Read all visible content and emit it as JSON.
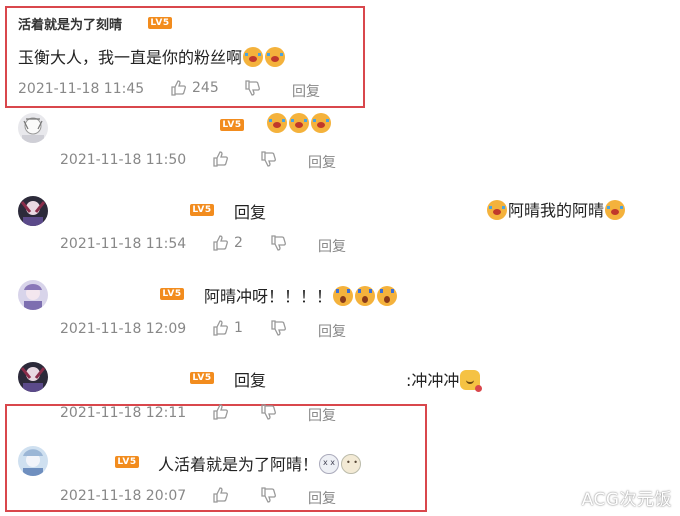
{
  "comments": [
    {
      "username": "活着就是为了刻晴",
      "level_badge": "LV5",
      "content": "玉衡大人，我一直是你的粉丝啊",
      "timestamp": "2021-11-18 11:45",
      "likes": "245",
      "reply_label": "回复"
    },
    {
      "username": "",
      "level_badge": "LV5",
      "content": "",
      "timestamp": "2021-11-18 11:50",
      "likes": "",
      "reply_label": "回复"
    },
    {
      "username": "",
      "level_badge": "LV5",
      "reply_prefix": "回复",
      "content": "阿晴我的阿晴",
      "timestamp": "2021-11-18 11:54",
      "likes": "2",
      "reply_label": "回复"
    },
    {
      "username": "",
      "level_badge": "LV5",
      "content": "阿晴冲呀！！！！",
      "timestamp": "2021-11-18 12:09",
      "likes": "1",
      "reply_label": "回复"
    },
    {
      "username": "",
      "level_badge": "LV5",
      "reply_prefix": "回复",
      "content": ":冲冲冲",
      "timestamp": "2021-11-18 12:11",
      "likes": "",
      "reply_label": "回复"
    },
    {
      "username": "",
      "level_badge": "LV5",
      "content": "人活着就是为了阿晴！",
      "timestamp": "2021-11-18 20:07",
      "likes": "",
      "reply_label": "回复"
    }
  ],
  "colors": {
    "highlight_border": "#d9474c",
    "level_badge": "#f28c1e",
    "meta_text": "#888888"
  },
  "icons": [
    "thumbs-up-icon",
    "thumbs-down-icon",
    "crying-emoji-icon",
    "shocked-emoji-icon",
    "cat-emoji-icon",
    "bunny-emoji-icon"
  ],
  "watermark": "ACG次元饭"
}
